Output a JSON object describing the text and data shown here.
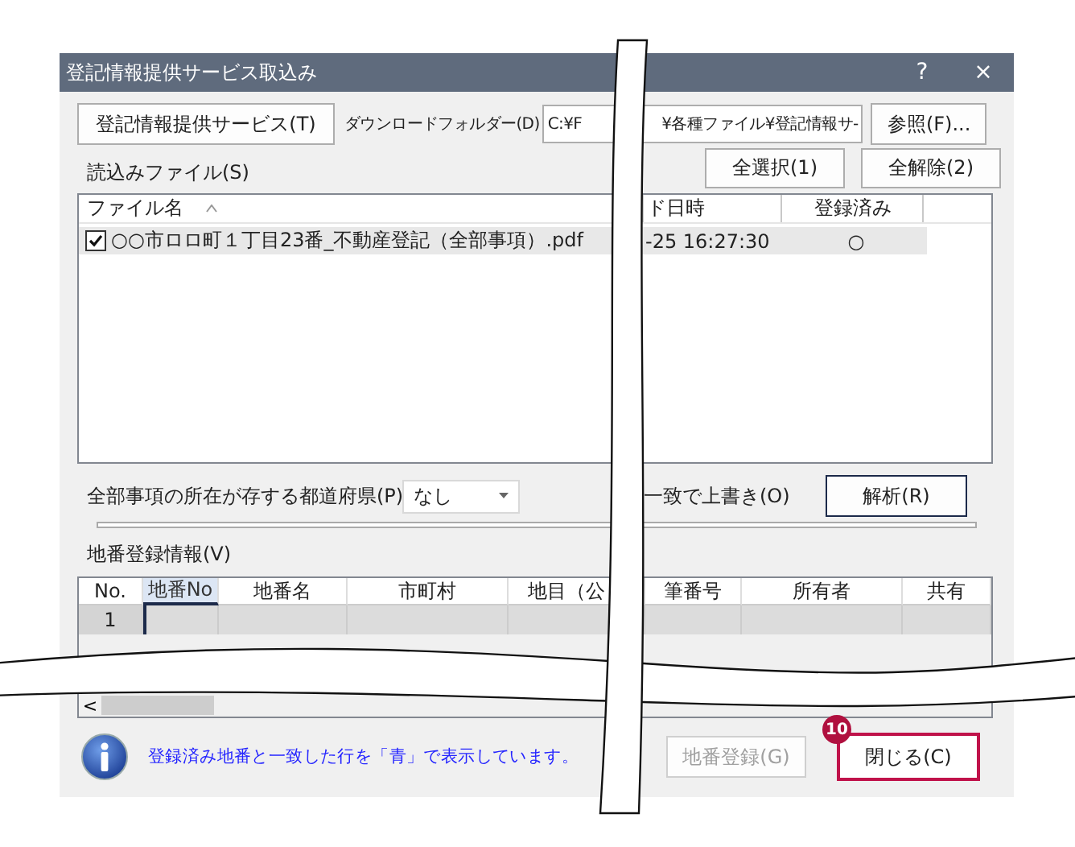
{
  "window": {
    "title": "登記情報提供サービス取込み",
    "help": "?",
    "close": "×"
  },
  "service_button": "登記情報提供サービス(T)",
  "download_folder": {
    "label": "ダウンロードフォルダー(D)",
    "value_start": "C:¥F",
    "value_end": "¥各種ファイル¥登記情報サ-",
    "browse_button": "参照(F)..."
  },
  "select_all_button": "全選択(1)",
  "deselect_all_button": "全解除(2)",
  "files": {
    "label": "読込みファイル(S)",
    "columns": [
      "ファイル名",
      "ド日時",
      "登録済み"
    ],
    "rows": [
      {
        "checked": true,
        "selected": true,
        "name": "○○市ロロ町１丁目23番_不動産登記（全部事項）.pdf",
        "datetime": "-25 16:27:30",
        "registered": "○"
      }
    ]
  },
  "prefecture": {
    "label": "全部事項の所在が存する都道府県(P)",
    "value": "なし"
  },
  "overwrite_label": "一致で上書き(O)",
  "analyze_button": "解析(R)",
  "progress": {
    "level": 0
  },
  "parcels": {
    "label": "地番登録情報(V)",
    "columns": [
      {
        "label": "No.",
        "selected": false
      },
      {
        "label": "地番No",
        "selected": true
      },
      {
        "label": "地番名",
        "selected": false
      },
      {
        "label": "市町村",
        "selected": false
      },
      {
        "label": "地目（公",
        "selected": false
      },
      {
        "label": "筆番号",
        "selected": false
      },
      {
        "label": "所有者",
        "selected": false
      },
      {
        "label": "共有",
        "selected": false
      }
    ],
    "rows": [
      {
        "no": "1"
      }
    ],
    "scroll_left": "<"
  },
  "info_message": "登録済み地番と一致した行を「青」で表示しています。",
  "register_button": {
    "label": "地番登録(G)",
    "disabled": true
  },
  "close_button": {
    "label": "閉じる(C)",
    "highlighted": true
  },
  "callout_badge": "10"
}
